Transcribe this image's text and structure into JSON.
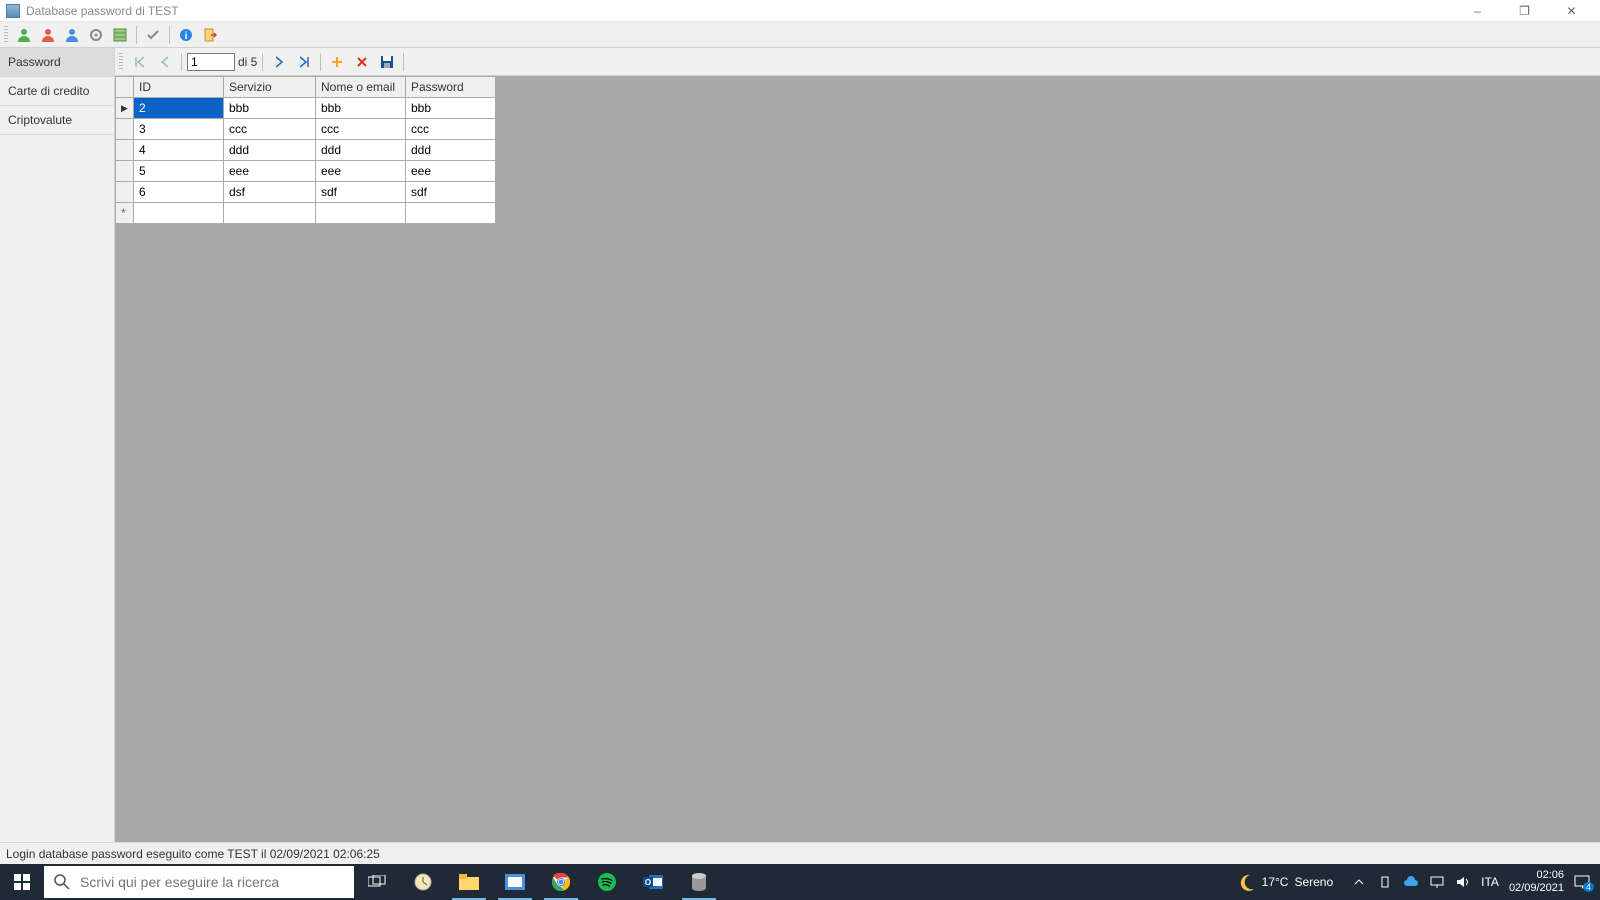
{
  "window": {
    "title": "Database password di TEST",
    "minimize": "–",
    "maximize": "❐",
    "close": "✕"
  },
  "sidebar": {
    "items": [
      {
        "label": "Password",
        "active": true
      },
      {
        "label": "Carte di credito",
        "active": false
      },
      {
        "label": "Criptovalute",
        "active": false
      }
    ]
  },
  "navigator": {
    "current": "1",
    "total_label": "di 5"
  },
  "grid": {
    "headers": {
      "id": "ID",
      "servizio": "Servizio",
      "nome": "Nome o email",
      "password": "Password"
    },
    "rows": [
      {
        "id": "2",
        "servizio": "bbb",
        "nome": "bbb",
        "password": "bbb",
        "selected": true,
        "marker": "▶"
      },
      {
        "id": "3",
        "servizio": "ccc",
        "nome": "ccc",
        "password": "ccc",
        "selected": false,
        "marker": ""
      },
      {
        "id": "4",
        "servizio": "ddd",
        "nome": "ddd",
        "password": "ddd",
        "selected": false,
        "marker": ""
      },
      {
        "id": "5",
        "servizio": "eee",
        "nome": "eee",
        "password": "eee",
        "selected": false,
        "marker": ""
      },
      {
        "id": "6",
        "servizio": "dsf",
        "nome": "sdf",
        "password": "sdf",
        "selected": false,
        "marker": ""
      }
    ],
    "newrow_marker": "*"
  },
  "status": {
    "text": "Login database password eseguito come TEST il 02/09/2021 02:06:25"
  },
  "taskbar": {
    "search_placeholder": "Scrivi qui per eseguire la ricerca",
    "weather_temp": "17°C",
    "weather_desc": "Sereno",
    "lang": "ITA",
    "time": "02:06",
    "date": "02/09/2021",
    "notif_count": "4"
  }
}
